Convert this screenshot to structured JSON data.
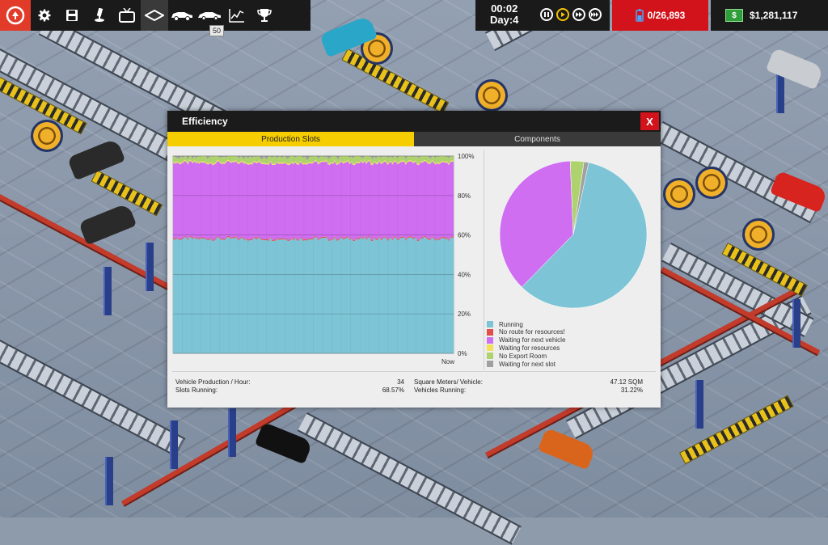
{
  "menubar": {
    "icons": [
      "logo-icon",
      "settings-icon",
      "save-icon",
      "research-icon",
      "tv-icon",
      "layout-icon",
      "vehicle-icon",
      "car-icon",
      "chart-icon",
      "trophy-icon"
    ],
    "tooltip": "50"
  },
  "time": {
    "clock": "00:02",
    "day": "Day:4"
  },
  "population": {
    "value": "0/26,893"
  },
  "money": {
    "value": "$1,281,117"
  },
  "window": {
    "title": "Efficiency",
    "close_label": "X",
    "tabs": [
      "Production Slots",
      "Components"
    ],
    "active_tab": "Production Slots"
  },
  "chart_data": [
    {
      "type": "area",
      "stacked": true,
      "y_ticks": [
        "100%",
        "80%",
        "60%",
        "40%",
        "20%",
        "0%"
      ],
      "ylim": [
        0,
        100
      ],
      "x_label_right": "Now",
      "grid": true,
      "series": [
        {
          "name": "Running",
          "color": "#7cc4d6",
          "approx_share": 58
        },
        {
          "name": "No route for resources!",
          "color": "#e0504a",
          "approx_share": 0.5
        },
        {
          "name": "Waiting for next vehicle",
          "color": "#cf6ef1",
          "approx_share": 38
        },
        {
          "name": "Waiting for resources",
          "color": "#f3e15a",
          "approx_share": 0.5
        },
        {
          "name": "No Export Room",
          "color": "#aed36e",
          "approx_share": 2.5
        },
        {
          "name": "Waiting for next slot",
          "color": "#a0a0a0",
          "approx_share": 0.5
        }
      ]
    },
    {
      "type": "pie",
      "values": [
        {
          "label": "Running",
          "value": 59
        },
        {
          "label": "Waiting for next vehicle",
          "value": 37
        },
        {
          "label": "No Export Room",
          "value": 3
        },
        {
          "label": "Waiting for next slot",
          "value": 1
        }
      ],
      "legend": [
        {
          "label": "Running",
          "color": "#7cc4d6"
        },
        {
          "label": "No route for resources!",
          "color": "#e0504a"
        },
        {
          "label": "Waiting for next vehicle",
          "color": "#cf6ef1"
        },
        {
          "label": "Waiting for resources",
          "color": "#f3e15a"
        },
        {
          "label": "No Export Room",
          "color": "#aed36e"
        },
        {
          "label": "Waiting for next slot",
          "color": "#a0a0a0"
        }
      ]
    }
  ],
  "stats": {
    "vph_label": "Vehicle Production / Hour:",
    "vph_value": "34",
    "slots_label": "Slots Running:",
    "slots_value": "68.57%",
    "sqm_label": "Square Meters/ Vehicle:",
    "sqm_value": "47.12 SQM",
    "vr_label": "Vehicles Running:",
    "vr_value": "31.22%"
  }
}
